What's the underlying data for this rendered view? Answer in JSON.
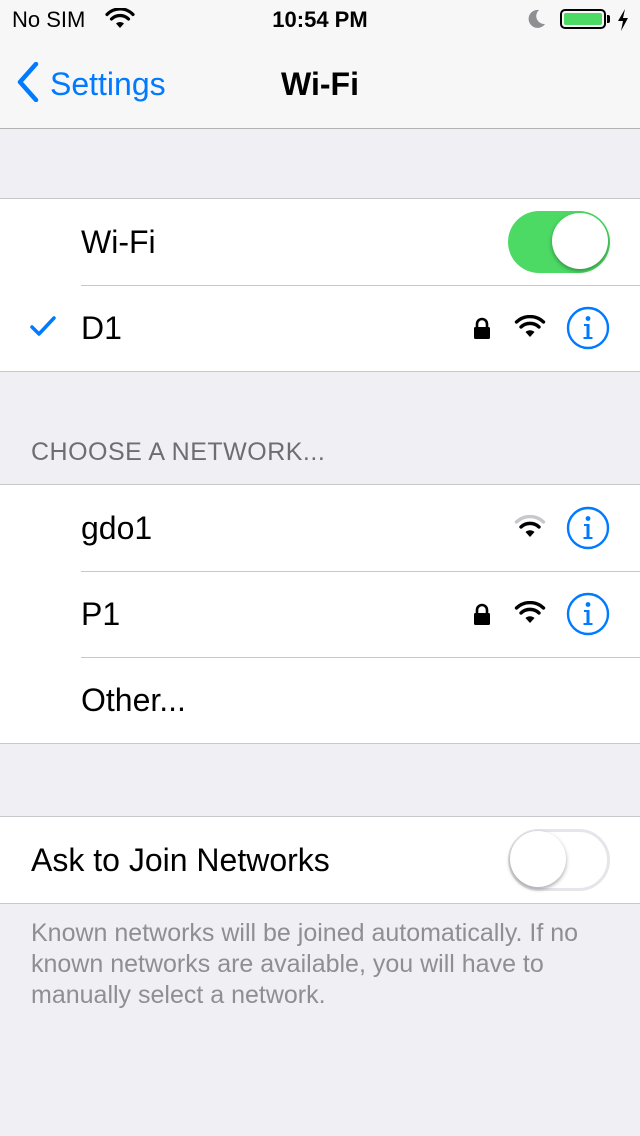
{
  "status_bar": {
    "carrier": "No SIM",
    "time": "10:54 PM",
    "battery_level": 1.0,
    "icons": [
      "wifi-icon",
      "moon-icon",
      "battery-icon",
      "charging-bolt-icon"
    ]
  },
  "nav": {
    "back_label": "Settings",
    "title": "Wi-Fi"
  },
  "wifi_section": {
    "toggle_label": "Wi-Fi",
    "toggle_on": true,
    "connected_network": {
      "name": "D1",
      "secured": true,
      "signal": "full"
    }
  },
  "networks_section": {
    "header": "CHOOSE A NETWORK...",
    "networks": [
      {
        "name": "gdo1",
        "secured": false,
        "signal": "partial"
      },
      {
        "name": "P1",
        "secured": true,
        "signal": "full"
      }
    ],
    "other_label": "Other..."
  },
  "ask_section": {
    "label": "Ask to Join Networks",
    "toggle_on": false,
    "footer": "Known networks will be joined automatically. If no known networks are available, you will have to manually select a network."
  },
  "colors": {
    "accent": "#007aff",
    "toggle_on": "#4cd964",
    "background": "#efeff4"
  }
}
